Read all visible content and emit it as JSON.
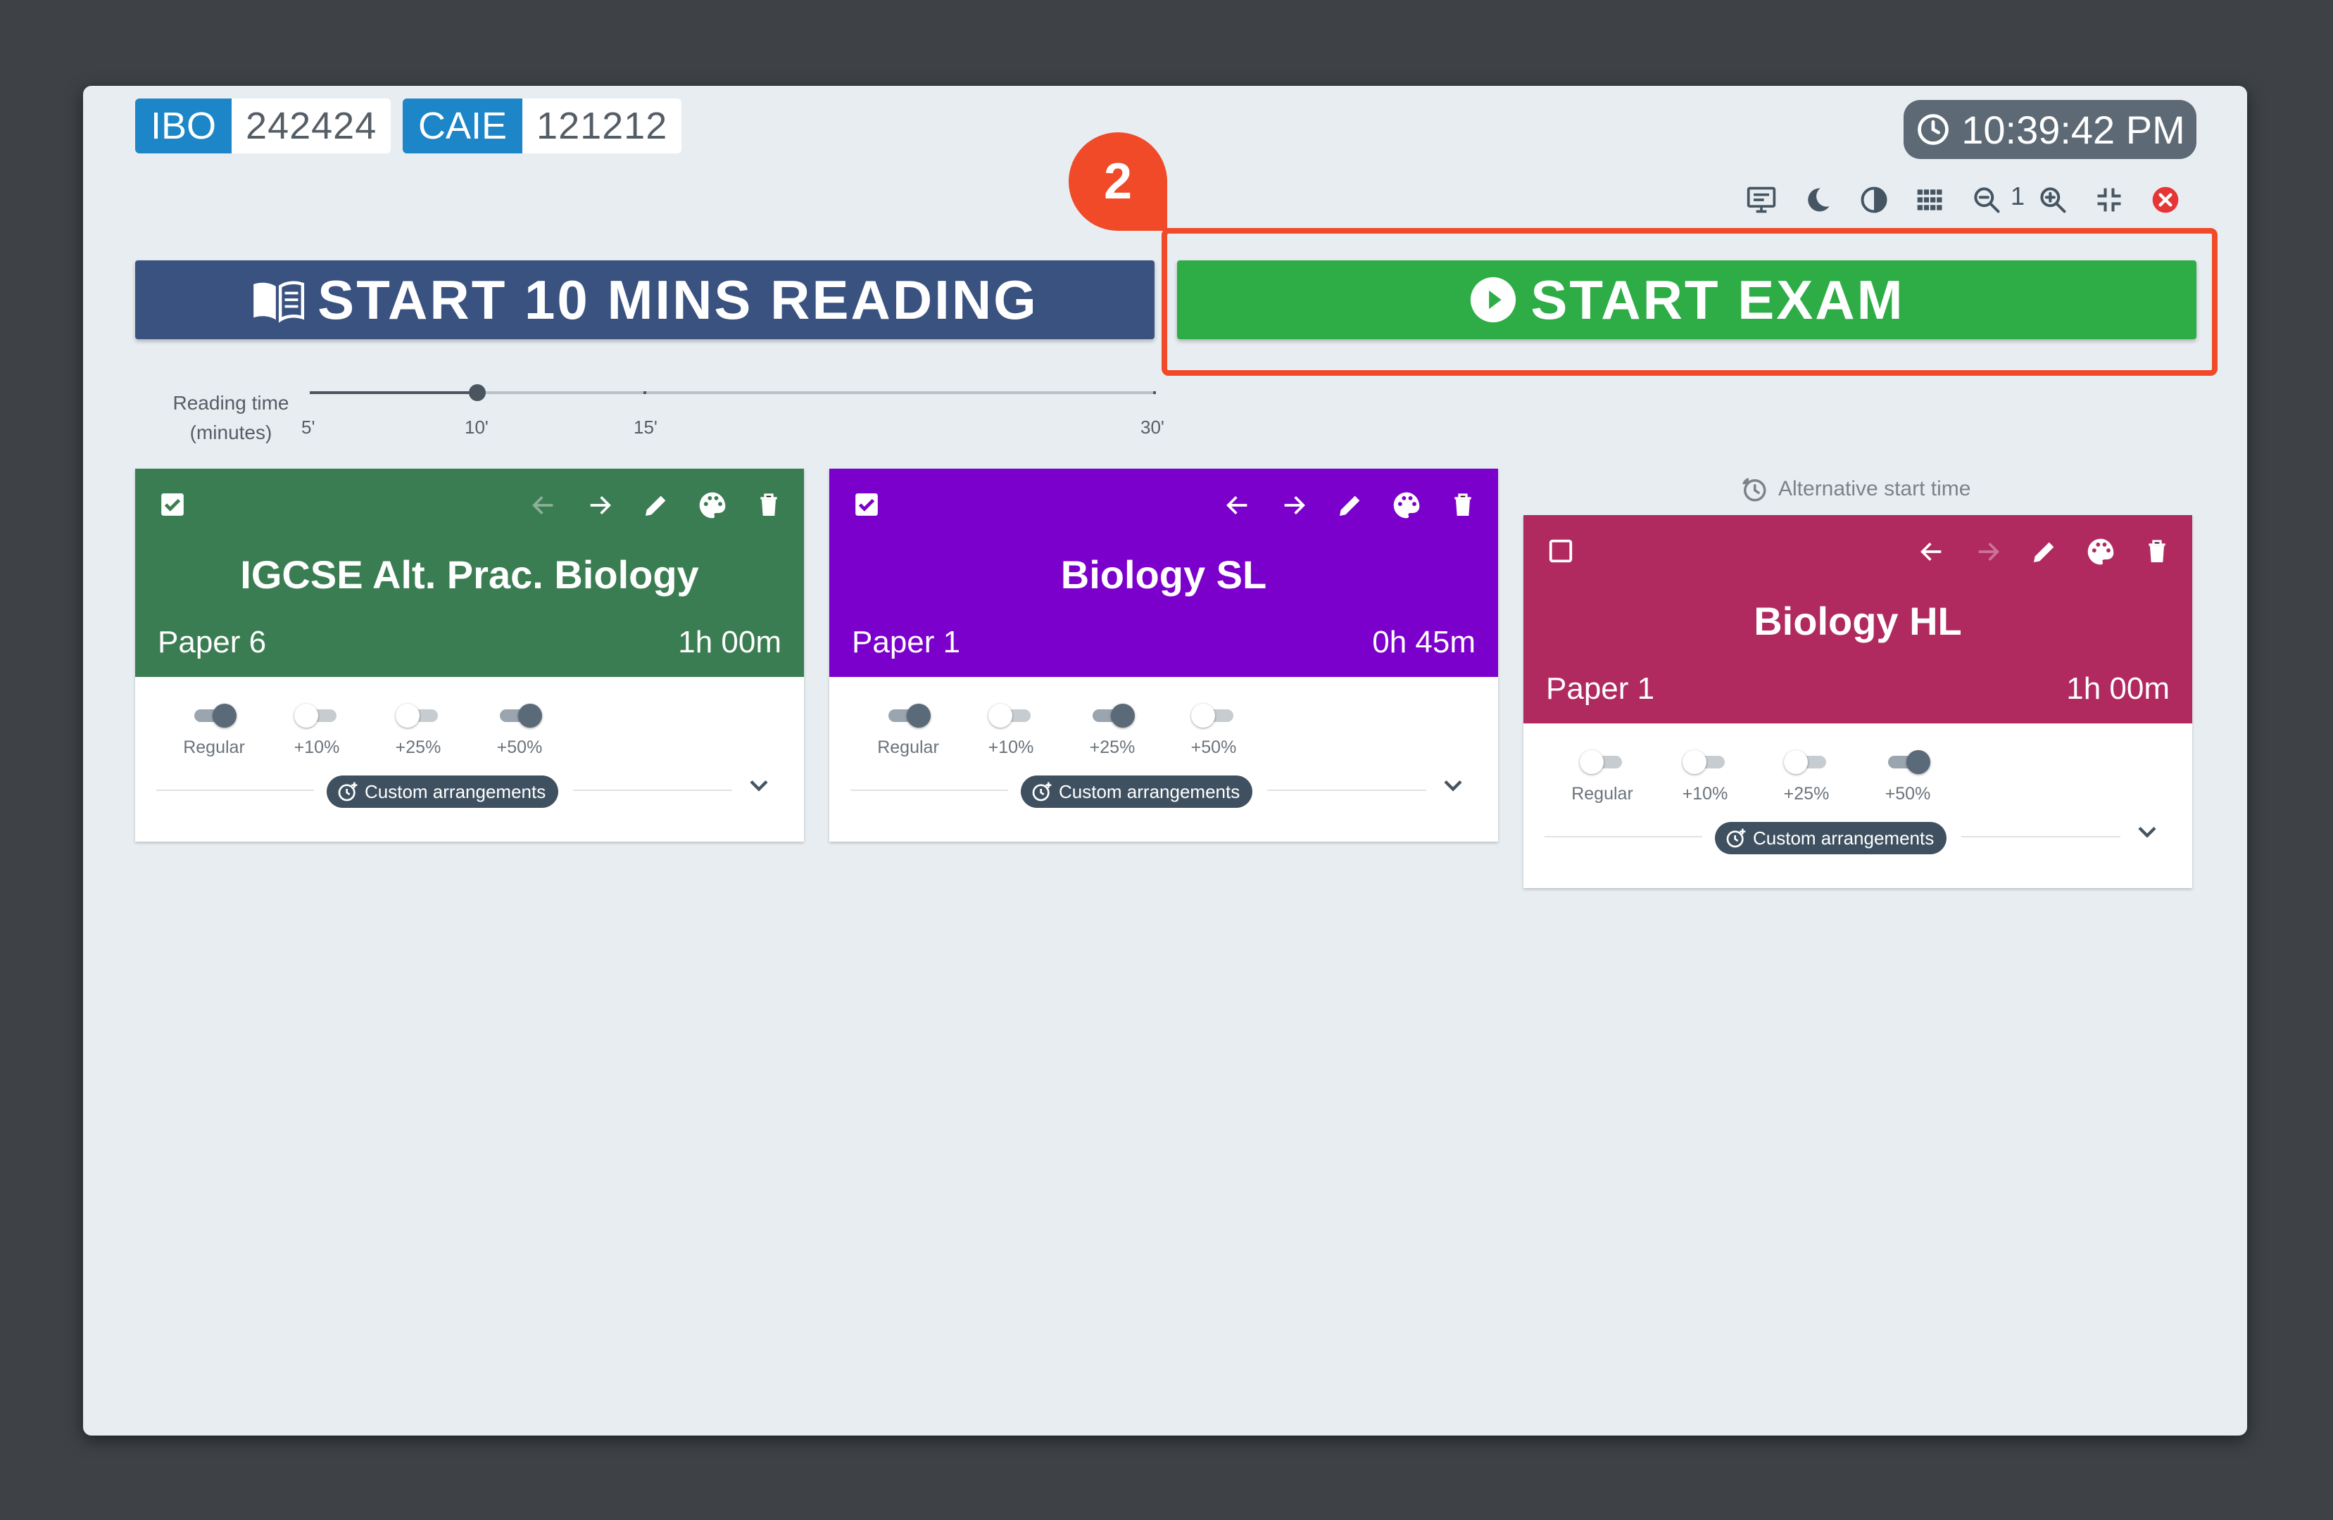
{
  "sessions": [
    {
      "board": "IBO",
      "code": "242424"
    },
    {
      "board": "CAIE",
      "code": "121212"
    }
  ],
  "clock": {
    "time": "10:39:42 PM"
  },
  "toolbar": {
    "zoom_level": "1",
    "icons": [
      "presentation-icon",
      "dark-mode-icon",
      "contrast-icon",
      "grid-icon",
      "zoom-out-icon",
      "zoom-in-icon",
      "exit-fullscreen-icon",
      "close-icon"
    ]
  },
  "marker": {
    "step": "2"
  },
  "buttons": {
    "reading": "START 10 MINS READING",
    "exam": "START EXAM"
  },
  "reading_slider": {
    "label_line1": "Reading time",
    "label_line2": "(minutes)",
    "ticks": [
      "5'",
      "10'",
      "15'",
      "30'"
    ],
    "value": "10'"
  },
  "alt_start": {
    "label": "Alternative start time"
  },
  "cards": [
    {
      "title": "IGCSE Alt. Prac. Biology",
      "paper": "Paper 6",
      "duration": "1h 00m",
      "color": "#3b7d52",
      "checked": true,
      "toggles": [
        {
          "label": "Regular",
          "on": true
        },
        {
          "label": "+10%",
          "on": false
        },
        {
          "label": "+25%",
          "on": false
        },
        {
          "label": "+50%",
          "on": true
        }
      ],
      "custom_label": "Custom arrangements"
    },
    {
      "title": "Biology SL",
      "paper": "Paper 1",
      "duration": "0h 45m",
      "color": "#7c00cc",
      "checked": true,
      "toggles": [
        {
          "label": "Regular",
          "on": true
        },
        {
          "label": "+10%",
          "on": false
        },
        {
          "label": "+25%",
          "on": true
        },
        {
          "label": "+50%",
          "on": false
        }
      ],
      "custom_label": "Custom arrangements"
    },
    {
      "title": "Biology HL",
      "paper": "Paper 1",
      "duration": "1h 00m",
      "color": "#b02a60",
      "checked": false,
      "toggles": [
        {
          "label": "Regular",
          "on": false
        },
        {
          "label": "+10%",
          "on": false
        },
        {
          "label": "+25%",
          "on": false
        },
        {
          "label": "+50%",
          "on": true
        }
      ],
      "custom_label": "Custom arrangements"
    }
  ]
}
